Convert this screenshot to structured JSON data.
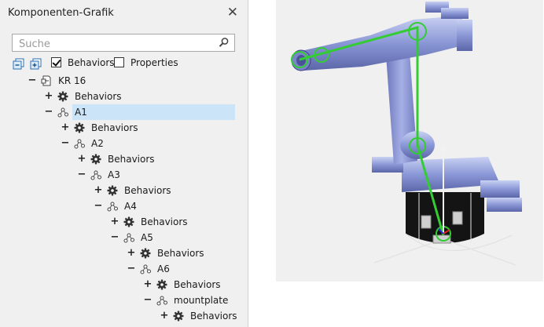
{
  "panel": {
    "title": "Komponenten-Grafik",
    "close_icon": "close-icon",
    "search": {
      "placeholder": "Suche",
      "value": ""
    },
    "toolbar": {
      "behaviors_label": "Behaviors",
      "behaviors_checked": true,
      "properties_label": "Properties",
      "properties_checked": false
    }
  },
  "tree": [
    {
      "label": "KR 16",
      "expander": "−",
      "icon": "component-icon",
      "level": 0
    },
    {
      "label": "Behaviors",
      "expander": "+",
      "icon": "gear-icon",
      "level": 1
    },
    {
      "label": "A1",
      "expander": "−",
      "icon": "node-icon",
      "level": 1,
      "selected": true
    },
    {
      "label": "Behaviors",
      "expander": "+",
      "icon": "gear-icon",
      "level": 2
    },
    {
      "label": "A2",
      "expander": "−",
      "icon": "node-icon",
      "level": 2
    },
    {
      "label": "Behaviors",
      "expander": "+",
      "icon": "gear-icon",
      "level": 3
    },
    {
      "label": "A3",
      "expander": "−",
      "icon": "node-icon",
      "level": 3
    },
    {
      "label": "Behaviors",
      "expander": "+",
      "icon": "gear-icon",
      "level": 4
    },
    {
      "label": "A4",
      "expander": "−",
      "icon": "node-icon",
      "level": 4
    },
    {
      "label": "Behaviors",
      "expander": "+",
      "icon": "gear-icon",
      "level": 5
    },
    {
      "label": "A5",
      "expander": "−",
      "icon": "node-icon",
      "level": 5
    },
    {
      "label": "Behaviors",
      "expander": "+",
      "icon": "gear-icon",
      "level": 6
    },
    {
      "label": "A6",
      "expander": "−",
      "icon": "node-icon",
      "level": 6
    },
    {
      "label": "Behaviors",
      "expander": "+",
      "icon": "gear-icon",
      "level": 7
    },
    {
      "label": "mountplate",
      "expander": "−",
      "icon": "node-icon",
      "level": 7
    },
    {
      "label": "Behaviors",
      "expander": "+",
      "icon": "gear-icon",
      "level": 8
    }
  ],
  "viewport": {
    "robot_color": "#8a97d6",
    "base_color": "#1a1a1a",
    "highlight_color": "#33cc33"
  },
  "colors": {
    "selection": "#cce4f7",
    "panel_bg": "#f0f0f0"
  }
}
